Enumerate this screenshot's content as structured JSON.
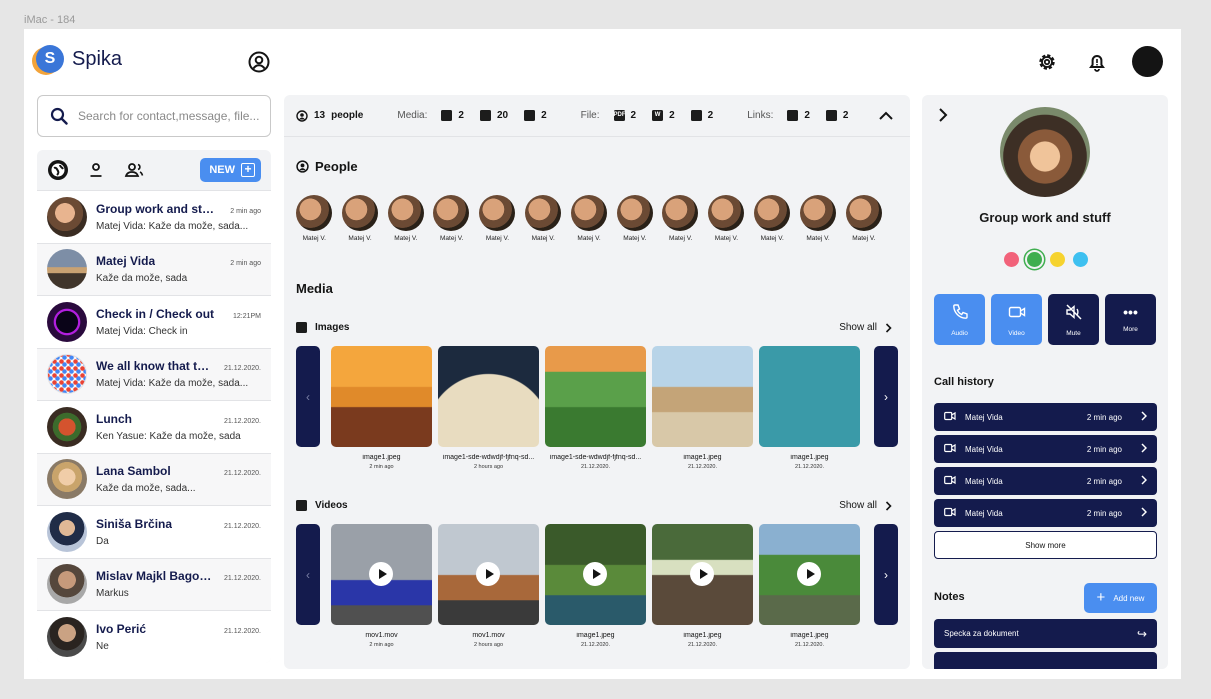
{
  "frame_label": "iMac - 184",
  "header": {
    "logo_letter": "S",
    "logo_text": "Spika"
  },
  "search": {
    "placeholder": "Search for contact,message, file..."
  },
  "left": {
    "new_label": "NEW",
    "chats": [
      {
        "name": "Group work and stuff",
        "time": "2 min ago",
        "message": "Matej Vida: Kaže da može, sada..."
      },
      {
        "name": "Matej Vida",
        "time": "2 min ago",
        "message": "Kaže da može, sada"
      },
      {
        "name": "Check in / Check out",
        "time": "12:21PM",
        "message": "Matej Vida: Check in"
      },
      {
        "name": "We all know that ther...",
        "time": "21.12.2020.",
        "message": "Matej Vida: Kaže da može, sada..."
      },
      {
        "name": "Lunch",
        "time": "21.12.2020.",
        "message": "Ken Yasue: Kaže da može, sada"
      },
      {
        "name": "Lana Sambol",
        "time": "21.12.2020.",
        "message": "Kaže da može, sada..."
      },
      {
        "name": "Siniša Brčina",
        "time": "21.12.2020.",
        "message": "Da"
      },
      {
        "name": "Mislav Majkl Bagović",
        "time": "21.12.2020.",
        "message": "Markus"
      },
      {
        "name": "Ivo Perić",
        "time": "21.12.2020.",
        "message": "Ne"
      }
    ]
  },
  "stats": {
    "people_count": "13",
    "people_label": "people",
    "media_label": "Media:",
    "media_images": "2",
    "media_videos": "20",
    "media_audio": "2",
    "file_label": "File:",
    "file_pdf_icon": "PDF",
    "file_pdf": "2",
    "file_word_icon": "W",
    "file_word": "2",
    "file_zip": "2",
    "links_label": "Links:",
    "links_drive": "2",
    "links_web": "2"
  },
  "people": {
    "title": "People",
    "members": [
      "Matej V.",
      "Matej V.",
      "Matej V.",
      "Matej V.",
      "Matej V.",
      "Matej V.",
      "Matej V.",
      "Matej V.",
      "Matej V.",
      "Matej V.",
      "Matej V.",
      "Matej V.",
      "Matej V."
    ]
  },
  "media": {
    "title": "Media",
    "images_label": "Images",
    "videos_label": "Videos",
    "show_all": "Show all",
    "images": [
      {
        "name": "image1.jpeg",
        "date": "2 min ago"
      },
      {
        "name": "image1-sde-wdwdjf-fjfnq-sd...",
        "date": "2 hours ago"
      },
      {
        "name": "image1-sde-wdwdjf-fjfnq-sd...",
        "date": "21.12.2020."
      },
      {
        "name": "image1.jpeg",
        "date": "21.12.2020."
      },
      {
        "name": "image1.jpeg",
        "date": "21.12.2020."
      }
    ],
    "videos": [
      {
        "name": "mov1.mov",
        "date": "2 min ago"
      },
      {
        "name": "mov1.mov",
        "date": "2 hours ago"
      },
      {
        "name": "image1.jpeg",
        "date": "21.12.2020."
      },
      {
        "name": "image1.jpeg",
        "date": "21.12.2020."
      },
      {
        "name": "image1.jpeg",
        "date": "21.12.2020."
      }
    ]
  },
  "right": {
    "group_name": "Group work and stuff",
    "colors": [
      "#f2627a",
      "#3fae4f",
      "#f6d32f",
      "#3ec0f0"
    ],
    "actions": {
      "audio": "Audio",
      "video": "Video",
      "mute": "Mute",
      "more": "More"
    },
    "call_history_title": "Call history",
    "calls": [
      {
        "name": "Matej Vida",
        "time": "2 min ago"
      },
      {
        "name": "Matej Vida",
        "time": "2 min ago"
      },
      {
        "name": "Matej Vida",
        "time": "2 min ago"
      },
      {
        "name": "Matej Vida",
        "time": "2 min ago"
      }
    ],
    "show_more": "Show more",
    "notes_title": "Notes",
    "add_new": "Add new",
    "note": "Specka za dokument"
  }
}
